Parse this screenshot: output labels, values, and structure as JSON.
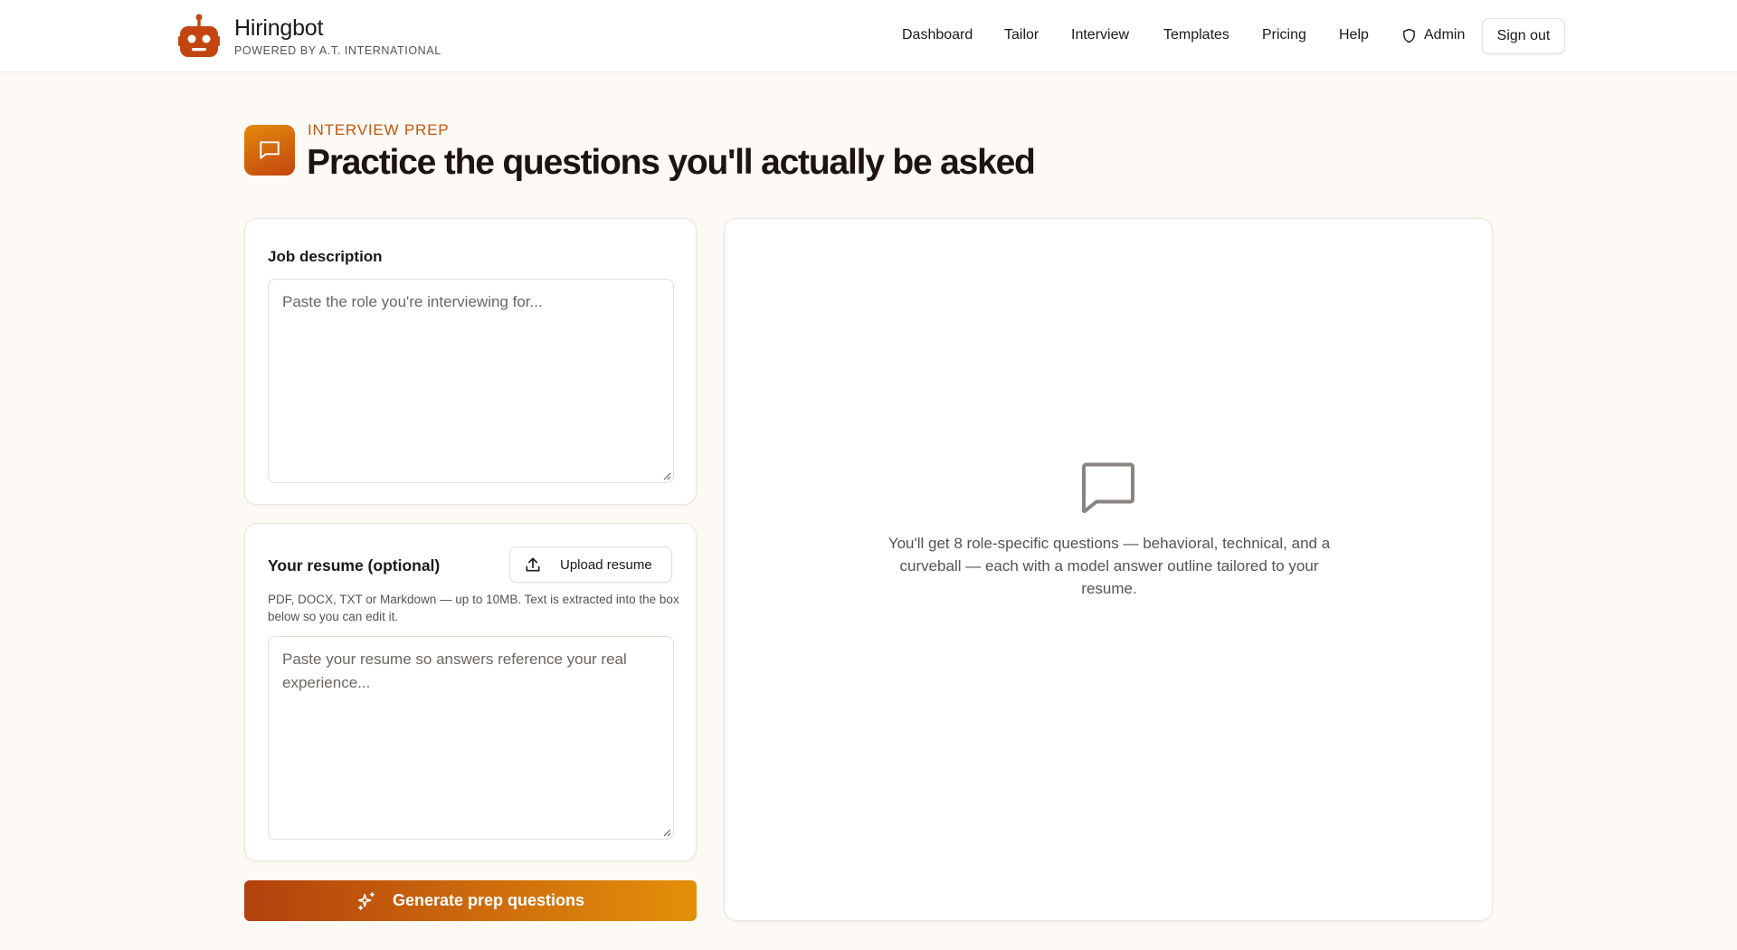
{
  "header": {
    "brand_name": "Hiringbot",
    "brand_sub": "POWERED BY A.T. INTERNATIONAL",
    "logo_icon": "robot-icon",
    "nav": [
      "Dashboard",
      "Tailor",
      "Interview",
      "Templates",
      "Pricing",
      "Help"
    ],
    "admin_label": "Admin",
    "admin_icon": "shield-icon",
    "signout_label": "Sign out"
  },
  "page": {
    "eyebrow": "INTERVIEW PREP",
    "title": "Practice the questions you'll actually be asked",
    "icon": "message-square-icon"
  },
  "job": {
    "label": "Job description",
    "placeholder": "Paste the role you're interviewing for...",
    "value": ""
  },
  "resume": {
    "label": "Your resume (optional)",
    "upload_label": "Upload resume",
    "upload_icon": "upload-icon",
    "hint": "PDF, DOCX, TXT or Markdown — up to 10MB. Text is extracted into the box below so you can edit it.",
    "placeholder": "Paste your resume so answers reference your real experience...",
    "value": ""
  },
  "generate": {
    "label": "Generate prep questions",
    "icon": "sparkles-icon"
  },
  "output": {
    "empty_icon": "message-square-icon",
    "empty_text": "You'll get 8 role-specific questions — behavioral, technical, and a curveball — each with a model answer outline tailored to your resume."
  },
  "colors": {
    "accent": "#c2570c",
    "gradient_start": "#b3410d",
    "gradient_end": "#e4900a",
    "page_bg": "#fdf9f5"
  }
}
